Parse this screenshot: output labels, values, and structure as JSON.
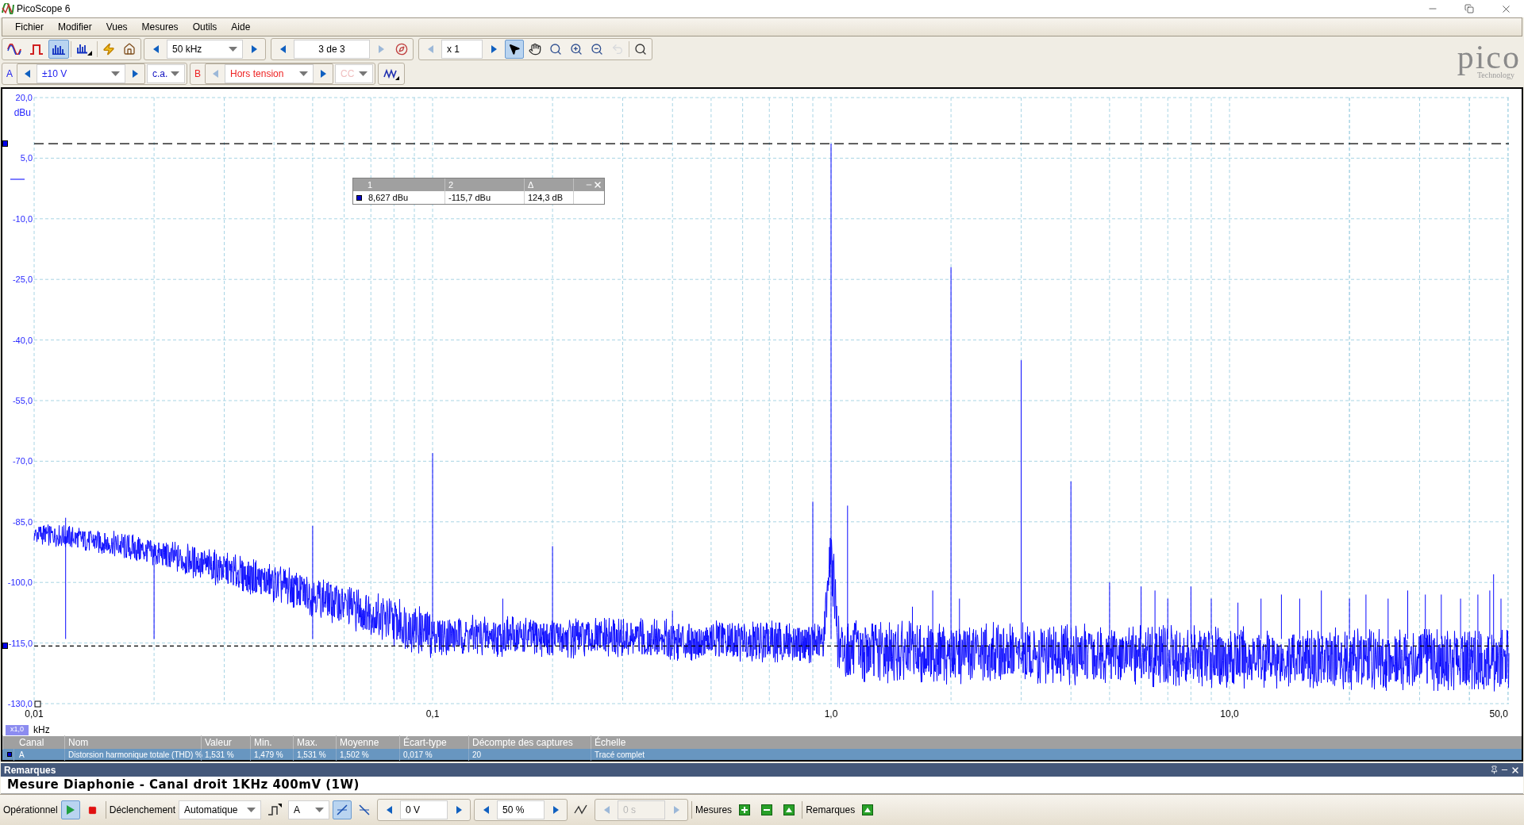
{
  "window": {
    "title": "PicoScope 6"
  },
  "menu": [
    "Fichier",
    "Modifier",
    "Vues",
    "Mesures",
    "Outils",
    "Aide"
  ],
  "toolbar": {
    "modes": [
      {
        "kind": "scope",
        "selected": false
      },
      {
        "kind": "persistence",
        "selected": false
      },
      {
        "kind": "spectrum",
        "selected": true
      },
      {
        "kind": "new-spectrum",
        "selected": false
      }
    ],
    "frequency": "50 kHz",
    "capture": "3 de 3",
    "zoom": "x 1",
    "tools": [
      {
        "kind": "pointer",
        "selected": true,
        "disabled": false
      },
      {
        "kind": "hand",
        "selected": false,
        "disabled": false
      },
      {
        "kind": "zoom-area",
        "selected": false,
        "disabled": false
      },
      {
        "kind": "zoom-in",
        "selected": false,
        "disabled": false
      },
      {
        "kind": "zoom-out",
        "selected": false,
        "disabled": false
      },
      {
        "kind": "undo",
        "selected": false,
        "disabled": true
      }
    ]
  },
  "logo": {
    "name": "pico",
    "subtitle": "Technology"
  },
  "channels": [
    {
      "name": "A",
      "color": "#2222ee",
      "range": "±10 V",
      "coupling": "c.a.",
      "enabled": true
    },
    {
      "name": "B",
      "color": "#ee2222",
      "range": "Hors tension",
      "coupling": "CC",
      "enabled": false
    }
  ],
  "chart": {
    "y_ticks": [
      "20,0",
      "5,0",
      "-10,0",
      "-25,0",
      "-40,0",
      "-55,0",
      "-70,0",
      "-85,0",
      "-100,0",
      "-115,0",
      "-130,0"
    ],
    "y_unit": "dBu",
    "x_ticks": [
      "0,01",
      "0,1",
      "1,0",
      "10,0",
      "50,0"
    ],
    "x_unit": "kHz",
    "x_scale": "x1,0",
    "readout": {
      "headers": [
        "1",
        "2",
        "Δ"
      ],
      "values": [
        "8,627 dBu",
        "-115,7 dBu",
        "124,3 dB"
      ]
    }
  },
  "measurements": {
    "columns": [
      "Canal",
      "Nom",
      "Valeur",
      "Min.",
      "Max.",
      "Moyenne",
      "Écart-type",
      "Décompte des captures",
      "Échelle"
    ],
    "rows": [
      {
        "selected": true,
        "cells": [
          "A",
          "Distorsion harmonique totale (THD) %",
          "1,531 %",
          "1,479 %",
          "1,531 %",
          "1,502 %",
          "0,017 %",
          "20",
          "Tracé complet"
        ]
      }
    ]
  },
  "notes": {
    "title": "Remarques",
    "text": "Mesure Diaphonie - Canal droit 1KHz 400mV (1W)"
  },
  "status": {
    "run_label": "Opérationnel",
    "running": true,
    "trigger_label": "Déclenchement",
    "trigger_mode": "Automatique",
    "trigger_source": "A",
    "edges": [
      {
        "kind": "rising",
        "selected": true
      },
      {
        "kind": "falling",
        "selected": false
      }
    ],
    "threshold": "0 V",
    "pretrigger": "50 %",
    "delay": "0 s",
    "delay_disabled": true,
    "measures_label": "Mesures",
    "notes_label": "Remarques"
  }
}
